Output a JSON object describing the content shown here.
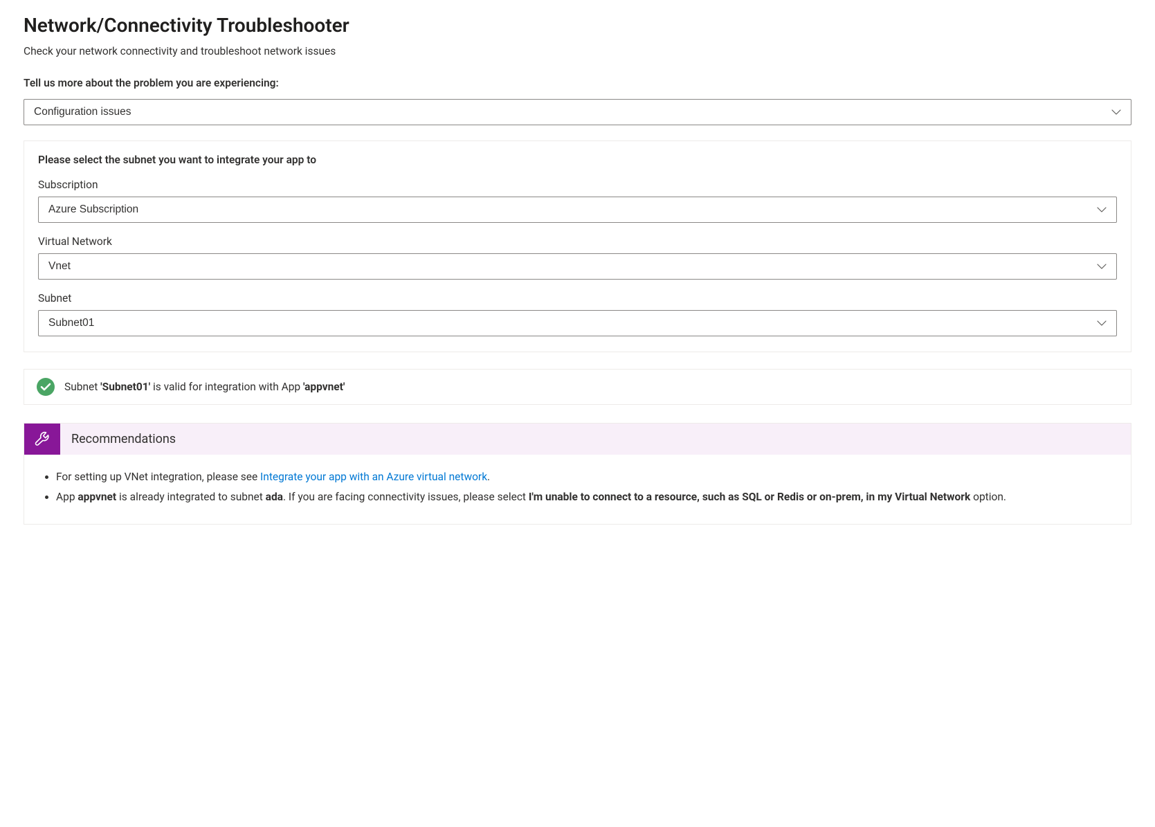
{
  "page": {
    "title": "Network/Connectivity Troubleshooter",
    "subtitle": "Check your network connectivity and troubleshoot network issues",
    "prompt_label": "Tell us more about the problem you are experiencing:",
    "problem_value": "Configuration issues"
  },
  "subnet_panel": {
    "title": "Please select the subnet you want to integrate your app to",
    "subscription_label": "Subscription",
    "subscription_value": "Azure Subscription",
    "vnet_label": "Virtual Network",
    "vnet_value": "Vnet",
    "subnet_label": "Subnet",
    "subnet_value": "Subnet01"
  },
  "status": {
    "prefix": "Subnet ",
    "subnet_quoted": "'Subnet01'",
    "mid": " is valid for integration with App ",
    "app_quoted": "'appvnet'"
  },
  "reco": {
    "header": "Recommendations",
    "item1_pre": "For setting up VNet integration, please see ",
    "item1_link": "Integrate your app with an Azure virtual network",
    "item1_post": ".",
    "item2_a": "App ",
    "item2_app": "appvnet",
    "item2_b": " is already integrated to subnet ",
    "item2_subnet": "ada",
    "item2_c": ". If you are facing connectivity issues, please select ",
    "item2_bold_option": "I'm unable to connect to a resource, such as SQL or Redis or on-prem, in my Virtual Network",
    "item2_d": " option."
  }
}
